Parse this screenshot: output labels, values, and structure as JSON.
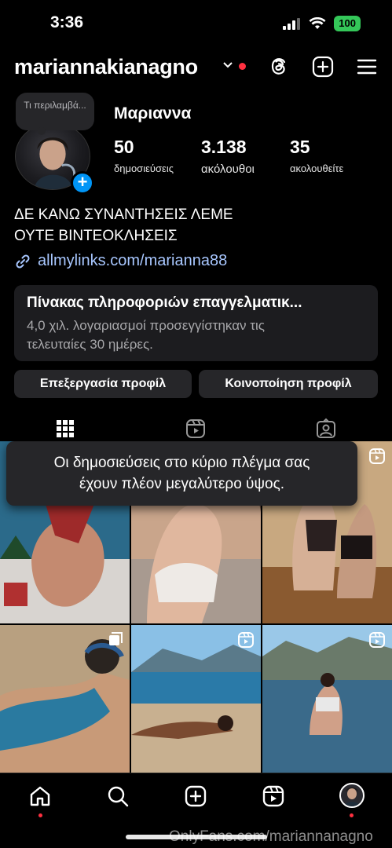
{
  "status_bar": {
    "time": "3:36",
    "battery": "100"
  },
  "header": {
    "username": "mariannakianagno"
  },
  "profile": {
    "note": "Τι περιλαμβά...",
    "display_name": "Μαριαννα",
    "stats": [
      {
        "value": "50",
        "label": "δημοσιεύσεις"
      },
      {
        "value": "3.138",
        "label": "ακόλουθοι"
      },
      {
        "value": "35",
        "label": "ακολουθείτε"
      }
    ],
    "bio_lines": [
      "ΔΕ ΚΑΝΩ ΣΥΝΑΝΤΗΣΕΙΣ ΛΕΜΕ",
      "ΟΥΤΕ ΒΙΝΤΕΟΚΛΗΣΕΙΣ"
    ],
    "link": "allmylinks.com/marianna88"
  },
  "dashboard": {
    "title": "Πίνακας πληροφοριών επαγγελματικ...",
    "subtitle_lines": [
      "4,0 χιλ. λογαριασμοί προσεγγίστηκαν τις",
      "τελευταίες 30 ημέρες."
    ]
  },
  "buttons": {
    "edit_profile": "Επεξεργασία προφίλ",
    "share_profile": "Κοινοποίηση προφίλ"
  },
  "tooltip": {
    "lines": [
      "Οι δημοσιεύσεις στο κύριο πλέγμα σας",
      "έχουν πλέον μεγαλύτερο ύψος."
    ]
  },
  "grid": {
    "posts": [
      {
        "kind": "photo",
        "colors": [
          "#2b6a8a",
          "#9e2a2a",
          "#d8d4d0"
        ]
      },
      {
        "kind": "photo",
        "colors": [
          "#c9a58b",
          "#e6d2c0",
          "#7a5a48"
        ]
      },
      {
        "kind": "reel",
        "colors": [
          "#8a6a4a",
          "#3a2a20",
          "#c8a880"
        ]
      },
      {
        "kind": "carousel",
        "colors": [
          "#b8a080",
          "#2a7aa0",
          "#5a4030"
        ]
      },
      {
        "kind": "reel",
        "colors": [
          "#6aa6d8",
          "#2a6a9a",
          "#c8b090"
        ]
      },
      {
        "kind": "reel",
        "colors": [
          "#8ab6d8",
          "#3a6a8a",
          "#5a7a8a"
        ]
      }
    ]
  },
  "watermark": "OnlyFans.com/mariannanagno",
  "colors": {
    "accent": "#0095f6",
    "link": "#a8c7ff",
    "notification": "#ff3040",
    "surface": "#262629"
  }
}
